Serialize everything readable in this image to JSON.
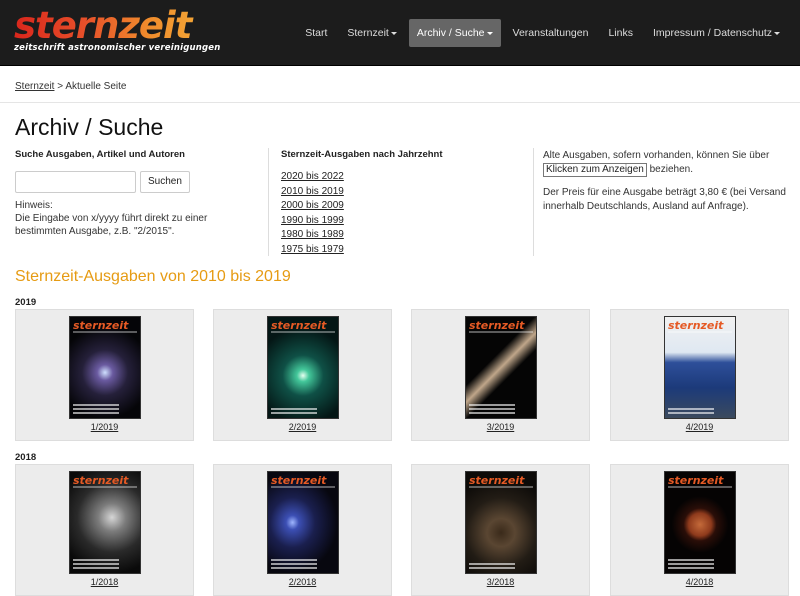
{
  "brand": {
    "name": "sternzeit",
    "tagline": "zeitschrift astronomischer vereinigungen"
  },
  "nav": {
    "items": [
      {
        "label": "Start"
      },
      {
        "label": "Sternzeit"
      },
      {
        "label": "Archiv / Suche"
      },
      {
        "label": "Veranstaltungen"
      },
      {
        "label": "Links"
      },
      {
        "label": "Impressum / Datenschutz"
      }
    ]
  },
  "breadcrumb": {
    "link": "Sternzeit",
    "current": "> Aktuelle Seite"
  },
  "page": {
    "title": "Archiv / Suche"
  },
  "search": {
    "heading": "Suche Ausgaben, Artikel und Autoren",
    "button": "Suchen",
    "placeholder": "",
    "hint_label": "Hinweis:",
    "hint_text": "Die Eingabe von x/yyyy führt direkt zu einer bestimmten Ausgabe, z.B. \"2/2015\"."
  },
  "decades": {
    "heading": "Sternzeit-Ausgaben nach Jahrzehnt",
    "items": [
      "2020 bis 2022",
      "2010 bis 2019",
      "2000 bis 2009",
      "1990 bis 1999",
      "1980 bis 1989",
      "1975 bis 1979"
    ]
  },
  "info": {
    "old_text_1": "Alte Ausgaben, sofern vorhanden, können Sie über",
    "old_button": "Klicken zum Anzeigen",
    "old_text_2": "beziehen.",
    "price": "Der Preis für eine Ausgabe beträgt 3,80 € (bei Versand innerhalb Deutschlands, Ausland auf Anfrage)."
  },
  "section": {
    "title": "Sternzeit-Ausgaben von 2010 bis 2019"
  },
  "years": [
    {
      "year": "2019",
      "issues": [
        "1/2019",
        "2/2019",
        "3/2019",
        "4/2019"
      ]
    },
    {
      "year": "2018",
      "issues": [
        "1/2018",
        "2/2018",
        "3/2018",
        "4/2018"
      ]
    }
  ],
  "colors": {
    "accent": "#e69b13",
    "nav_bg": "#1c1c1c",
    "nav_active": "#666666"
  }
}
